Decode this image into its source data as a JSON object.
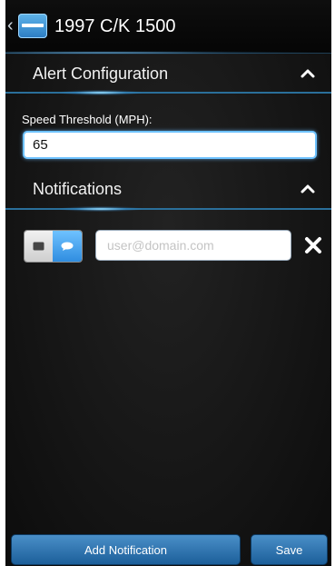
{
  "header": {
    "title": "1997 C/K 1500"
  },
  "alert_section": {
    "title": "Alert Configuration",
    "speed_label": "Speed Threshold (MPH):",
    "speed_value": "65"
  },
  "notifications_section": {
    "title": "Notifications",
    "entries": [
      {
        "email_placeholder": "user@domain.com",
        "email_value": ""
      }
    ]
  },
  "footer": {
    "add_label": "Add Notification",
    "save_label": "Save"
  },
  "colors": {
    "accent": "#6ec2ff",
    "button": "#2f74b0",
    "background": "#151515"
  },
  "icons": [
    "back-chevron-icon",
    "app-logo-icon",
    "caret-up-icon",
    "email-icon",
    "sms-icon",
    "close-icon"
  ]
}
